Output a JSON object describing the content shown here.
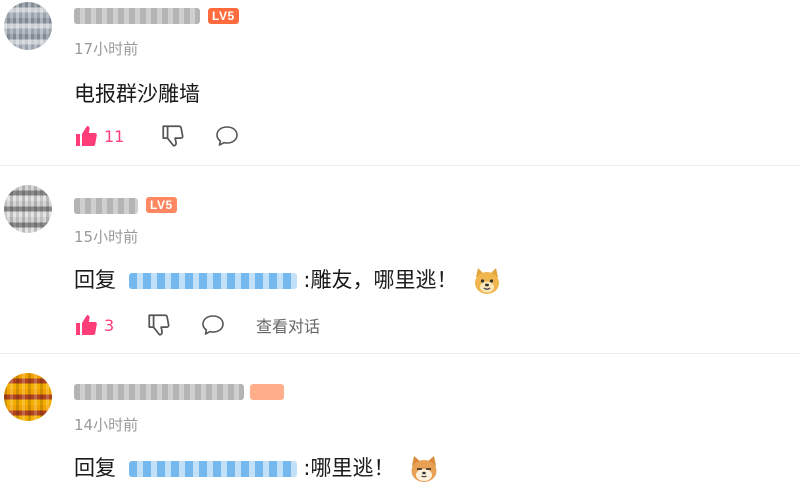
{
  "colors": {
    "like_pink": "#ff3d79",
    "mention_blue": "#4aa3e8",
    "badge_lv5": "#ff6b3d",
    "badge_lv6": "#ff8c5a"
  },
  "comments": [
    {
      "level_badge": "LV5",
      "time": "17小时前",
      "text": "电报群沙雕墙",
      "likes": "11"
    },
    {
      "level_badge": "LV5",
      "time": "15小时前",
      "reply_prefix": "回复",
      "reply_text": ":雕友，哪里逃！",
      "likes": "3",
      "view_replies": "查看对话"
    },
    {
      "time": "14小时前",
      "reply_prefix": "回复",
      "reply_text": ":哪里逃！"
    }
  ]
}
